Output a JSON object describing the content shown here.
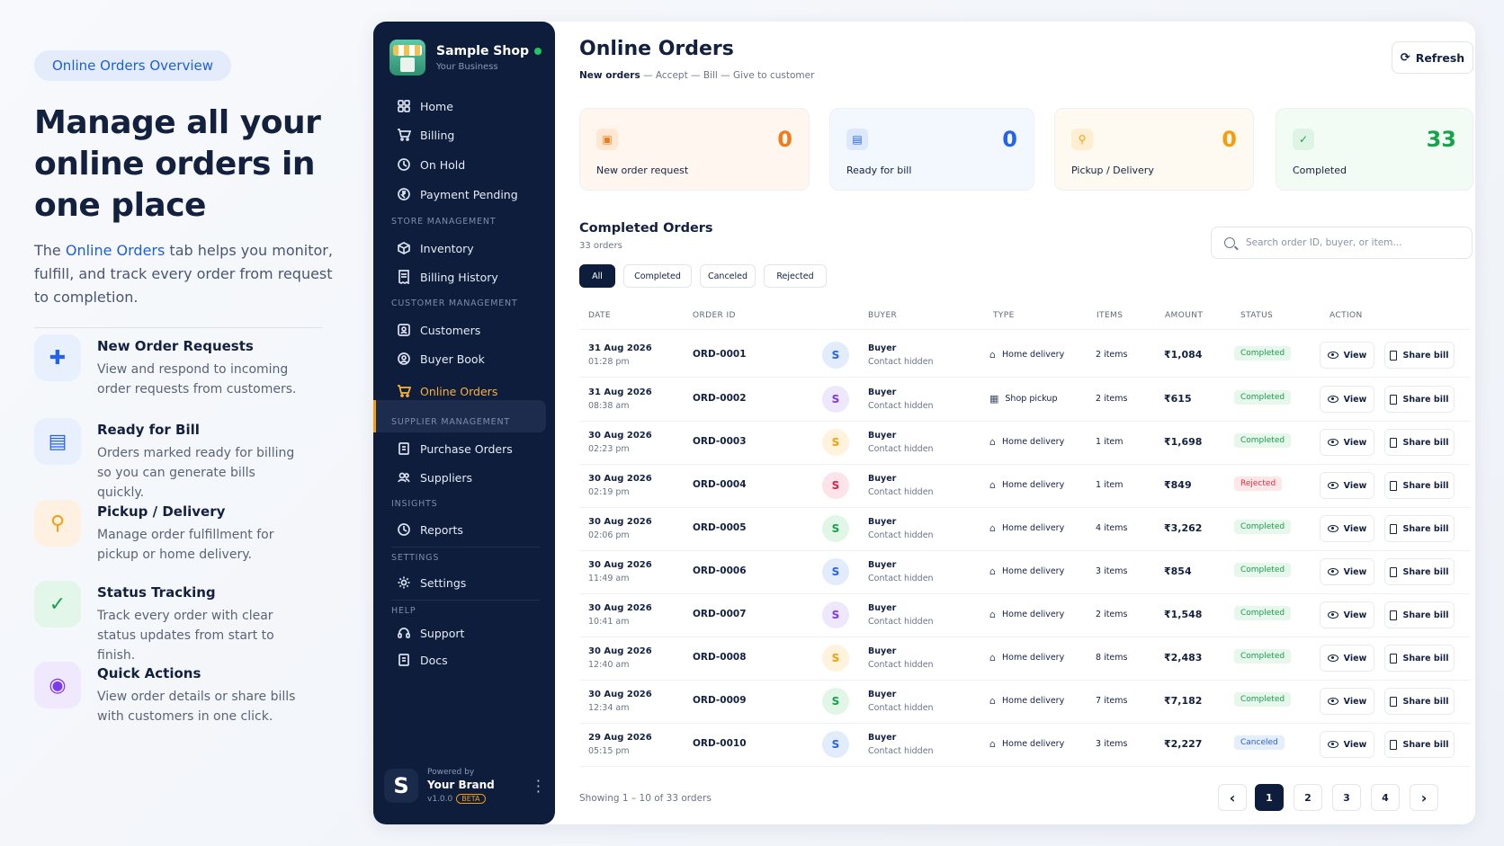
{
  "left": {
    "pill": "Online Orders Overview",
    "headline": "Manage all your online orders in one place",
    "intro_pre": "The ",
    "intro_link": "Online Orders",
    "intro_post": " tab helps you monitor, fulfill, and track every order from request to completion.",
    "features": [
      {
        "title": "New Order Requests",
        "desc": "View and respond to incoming order requests from customers.",
        "icon": "file-plus-icon"
      },
      {
        "title": "Ready for Bill",
        "desc": "Orders marked ready for billing so you can generate bills quickly.",
        "icon": "clipboard-icon"
      },
      {
        "title": "Pickup / Delivery",
        "desc": "Manage order fulfillment for pickup or home delivery.",
        "icon": "bike-icon"
      },
      {
        "title": "Status Tracking",
        "desc": "Track every order with clear status updates from start to finish.",
        "icon": "check-circle-icon"
      },
      {
        "title": "Quick Actions",
        "desc": "View order details or share bills with customers in one click.",
        "icon": "eye-icon"
      }
    ]
  },
  "sidebar": {
    "shop_name": "Sample Shop",
    "shop_sub": "Your Business",
    "nav": {
      "home": "Home",
      "billing": "Billing",
      "on_hold": "On Hold",
      "payment_pending": "Payment Pending",
      "inventory": "Inventory",
      "billing_history": "Billing History",
      "customers": "Customers",
      "buyer_book": "Buyer Book",
      "online_orders": "Online Orders",
      "purchase_orders": "Purchase Orders",
      "suppliers": "Suppliers",
      "reports": "Reports",
      "settings": "Settings",
      "support": "Support",
      "docs": "Docs"
    },
    "sections": {
      "store": "STORE MANAGEMENT",
      "customer": "CUSTOMER MANAGEMENT",
      "supplier": "SUPPLIER MANAGEMENT",
      "insights": "INSIGHTS",
      "settings": "SETTINGS",
      "help": "HELP"
    },
    "powered_by": "Powered by",
    "brand": "Your Brand",
    "version": "v1.0.0",
    "beta": "BETA"
  },
  "main": {
    "title": "Online Orders",
    "steps_bold": "New orders",
    "steps_rest": " — Accept — Bill — Give to customer",
    "refresh": "Refresh",
    "stats": [
      {
        "label": "New order request",
        "value": "0",
        "color": "#f07b1d",
        "bg": "#fff7ef",
        "icon_bg": "#ffe7d1",
        "icon": "receipt-icon"
      },
      {
        "label": "Ready for bill",
        "value": "0",
        "color": "#2563eb",
        "bg": "#f3f7fe",
        "icon_bg": "#dde8fd",
        "icon": "bill-icon"
      },
      {
        "label": "Pickup / Delivery",
        "value": "0",
        "color": "#f59e0b",
        "bg": "#fffaf1",
        "icon_bg": "#feefd2",
        "icon": "bike-icon"
      },
      {
        "label": "Completed",
        "value": "33",
        "color": "#16a34a",
        "bg": "#f3fbf5",
        "icon_bg": "#dff4e5",
        "icon": "check-circle-icon"
      }
    ],
    "completed_title": "Completed Orders",
    "completed_count": "33 orders",
    "search_placeholder": "Search order ID, buyer, or item...",
    "filters": [
      "All",
      "Completed",
      "Canceled",
      "Rejected"
    ],
    "columns": [
      "DATE",
      "ORDER ID",
      "BUYER",
      "TYPE",
      "ITEMS",
      "AMOUNT",
      "STATUS",
      "ACTION"
    ],
    "view_label": "View",
    "share_label": "Share bill",
    "rows": [
      {
        "date": "31 Aug 2026",
        "time": "01:28 pm",
        "id": "ORD-0001",
        "avatar": "S",
        "av_color": "#2563eb",
        "av_bg": "#e3ecfd",
        "buyer": "Buyer",
        "contact": "Contact hidden",
        "type": "Home delivery",
        "type_icon": "home-icon",
        "items": "2 items",
        "amount": "₹1,084",
        "status": "Completed",
        "st": "ok"
      },
      {
        "date": "31 Aug 2026",
        "time": "08:38 am",
        "id": "ORD-0002",
        "avatar": "S",
        "av_color": "#7c3aed",
        "av_bg": "#efe7fd",
        "buyer": "Buyer",
        "contact": "Contact hidden",
        "type": "Shop pickup",
        "type_icon": "store-icon",
        "items": "2 items",
        "amount": "₹615",
        "status": "Completed",
        "st": "ok"
      },
      {
        "date": "30 Aug 2026",
        "time": "02:23 pm",
        "id": "ORD-0003",
        "avatar": "S",
        "av_color": "#f59e0b",
        "av_bg": "#fef3dc",
        "buyer": "Buyer",
        "contact": "Contact hidden",
        "type": "Home delivery",
        "type_icon": "home-icon",
        "items": "1 item",
        "amount": "₹1,698",
        "status": "Completed",
        "st": "ok"
      },
      {
        "date": "30 Aug 2026",
        "time": "02:19 pm",
        "id": "ORD-0004",
        "avatar": "S",
        "av_color": "#e11d48",
        "av_bg": "#fde4ea",
        "buyer": "Buyer",
        "contact": "Contact hidden",
        "type": "Home delivery",
        "type_icon": "home-icon",
        "items": "1 item",
        "amount": "₹849",
        "status": "Rejected",
        "st": "rej"
      },
      {
        "date": "30 Aug 2026",
        "time": "02:06 pm",
        "id": "ORD-0005",
        "avatar": "S",
        "av_color": "#16a34a",
        "av_bg": "#e2f6e8",
        "buyer": "Buyer",
        "contact": "Contact hidden",
        "type": "Home delivery",
        "type_icon": "home-icon",
        "items": "4 items",
        "amount": "₹3,262",
        "status": "Completed",
        "st": "ok"
      },
      {
        "date": "30 Aug 2026",
        "time": "11:49 am",
        "id": "ORD-0006",
        "avatar": "S",
        "av_color": "#2563eb",
        "av_bg": "#e3ecfd",
        "buyer": "Buyer",
        "contact": "Contact hidden",
        "type": "Home delivery",
        "type_icon": "home-icon",
        "items": "3 items",
        "amount": "₹854",
        "status": "Completed",
        "st": "ok"
      },
      {
        "date": "30 Aug 2026",
        "time": "10:41 am",
        "id": "ORD-0007",
        "avatar": "S",
        "av_color": "#7c3aed",
        "av_bg": "#efe7fd",
        "buyer": "Buyer",
        "contact": "Contact hidden",
        "type": "Home delivery",
        "type_icon": "home-icon",
        "items": "2 items",
        "amount": "₹1,548",
        "status": "Completed",
        "st": "ok"
      },
      {
        "date": "30 Aug 2026",
        "time": "12:40 am",
        "id": "ORD-0008",
        "avatar": "S",
        "av_color": "#f59e0b",
        "av_bg": "#fef3dc",
        "buyer": "Buyer",
        "contact": "Contact hidden",
        "type": "Home delivery",
        "type_icon": "home-icon",
        "items": "8 items",
        "amount": "₹2,483",
        "status": "Completed",
        "st": "ok"
      },
      {
        "date": "30 Aug 2026",
        "time": "12:34 am",
        "id": "ORD-0009",
        "avatar": "S",
        "av_color": "#16a34a",
        "av_bg": "#e2f6e8",
        "buyer": "Buyer",
        "contact": "Contact hidden",
        "type": "Home delivery",
        "type_icon": "home-icon",
        "items": "7 items",
        "amount": "₹7,182",
        "status": "Completed",
        "st": "ok"
      },
      {
        "date": "29 Aug 2026",
        "time": "05:15 pm",
        "id": "ORD-0010",
        "avatar": "S",
        "av_color": "#2563eb",
        "av_bg": "#e3ecfd",
        "buyer": "Buyer",
        "contact": "Contact hidden",
        "type": "Home delivery",
        "type_icon": "home-icon",
        "items": "3 items",
        "amount": "₹2,227",
        "status": "Canceled",
        "st": "can"
      }
    ],
    "showing": "Showing 1 – 10 of 33 orders",
    "pages": [
      "1",
      "2",
      "3",
      "4"
    ],
    "current_page": "1"
  }
}
